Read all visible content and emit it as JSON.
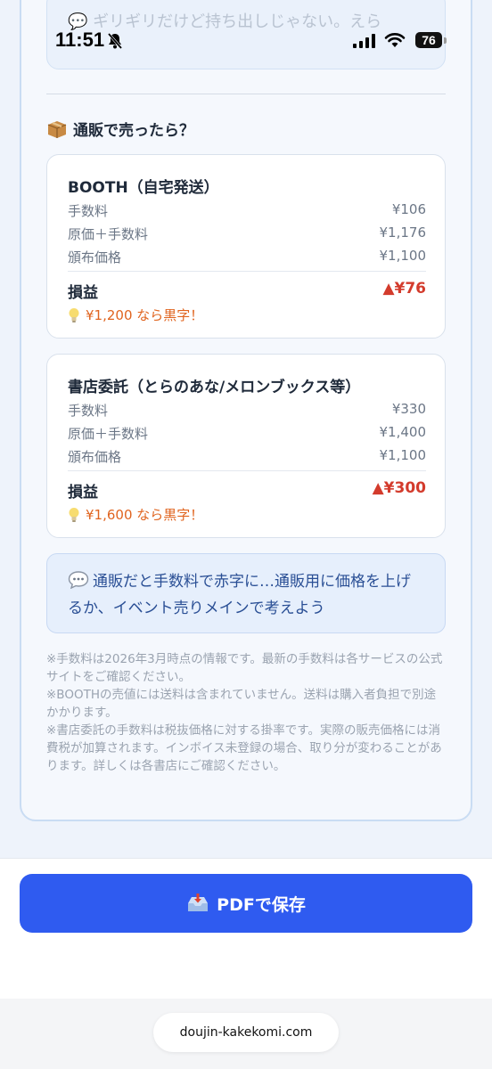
{
  "status_bar": {
    "time": "11:51",
    "battery": "76"
  },
  "faded_tip": "💬 ギリギリだけど持ち出しじゃない。えら",
  "mail_order": {
    "title": "通販で売ったら？",
    "cards": [
      {
        "name": "BOOTH（自宅発送）",
        "rows": [
          {
            "label": "手数料",
            "value": "¥106"
          },
          {
            "label": "原価＋手数料",
            "value": "¥1,176"
          },
          {
            "label": "頒布価格",
            "value": "¥1,100"
          }
        ],
        "profit_label": "損益",
        "profit_value": "▲¥76",
        "hint": "¥1,200 なら黒字！"
      },
      {
        "name": "書店委託（とらのあな/メロンブックス等）",
        "rows": [
          {
            "label": "手数料",
            "value": "¥330"
          },
          {
            "label": "原価＋手数料",
            "value": "¥1,400"
          },
          {
            "label": "頒布価格",
            "value": "¥1,100"
          }
        ],
        "profit_label": "損益",
        "profit_value": "▲¥300",
        "hint": "¥1,600 なら黒字！"
      }
    ],
    "advice": "通販だと手数料で赤字に…通販用に価格を上げるか、イベント売りメインで考えよう",
    "notes": [
      "※手数料は2026年3月時点の情報です。最新の手数料は各サービスの公式サイトをご確認ください。",
      "※BOOTHの売値には送料は含まれていません。送料は購入者負担で別途かかります。",
      "※書店委託の手数料は税抜価格に対する掛率です。実際の販売価格には消費税が加算されます。インボイス未登録の場合、取り分が変わることがあります。詳しくは各書店にご確認ください。"
    ]
  },
  "pdf_button": "PDFで保存",
  "url": "doujin-kakekomi.com",
  "colors": {
    "accent": "#2f5bf0",
    "loss": "#d33b2c",
    "hint": "#e0641f"
  }
}
